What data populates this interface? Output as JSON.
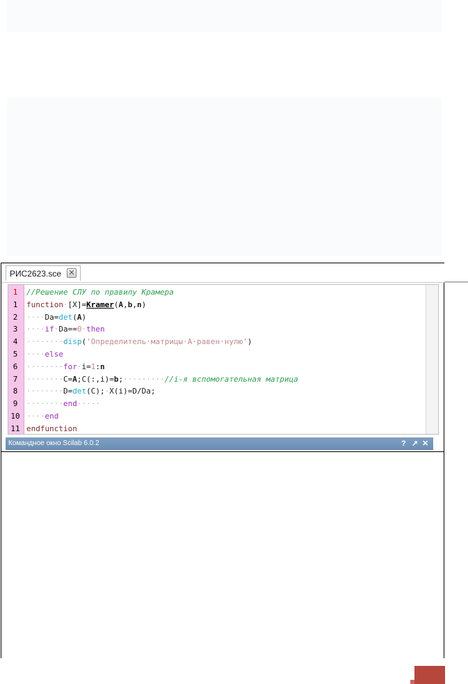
{
  "editor": {
    "tab_label": "РИС2623.sce",
    "tab_close_glyph": "✕",
    "lines": [
      {
        "num": "1",
        "tokens": [
          {
            "t": "//Решение СЛУ по правилу Крамера",
            "c": "cm"
          }
        ]
      },
      {
        "num": "1",
        "tokens": [
          {
            "t": "function",
            "c": "kw"
          },
          {
            "t": "·",
            "c": "dot"
          },
          {
            "t": "[X]",
            "c": "ident"
          },
          {
            "t": "=",
            "c": "ident"
          },
          {
            "t": "Kramer",
            "c": "under"
          },
          {
            "t": "(",
            "c": "ident"
          },
          {
            "t": "A",
            "c": "bold"
          },
          {
            "t": ",",
            "c": "ident"
          },
          {
            "t": "b",
            "c": "bold"
          },
          {
            "t": ",",
            "c": "ident"
          },
          {
            "t": "n",
            "c": "bold"
          },
          {
            "t": ")",
            "c": "ident"
          }
        ]
      },
      {
        "num": "2",
        "tokens": [
          {
            "t": "····",
            "c": "dot"
          },
          {
            "t": "Da",
            "c": "ident"
          },
          {
            "t": "=",
            "c": "ident"
          },
          {
            "t": "det",
            "c": "fn"
          },
          {
            "t": "(",
            "c": "ident"
          },
          {
            "t": "A",
            "c": "bold"
          },
          {
            "t": ")",
            "c": "ident"
          }
        ]
      },
      {
        "num": "3",
        "tokens": [
          {
            "t": "····",
            "c": "dot"
          },
          {
            "t": "if",
            "c": "kw2"
          },
          {
            "t": "·",
            "c": "dot"
          },
          {
            "t": "Da",
            "c": "ident"
          },
          {
            "t": "==",
            "c": "ident"
          },
          {
            "t": "0",
            "c": "num"
          },
          {
            "t": "·",
            "c": "dot"
          },
          {
            "t": "then",
            "c": "kw2"
          }
        ]
      },
      {
        "num": "4",
        "tokens": [
          {
            "t": "········",
            "c": "dot"
          },
          {
            "t": "disp",
            "c": "fn"
          },
          {
            "t": "(",
            "c": "ident"
          },
          {
            "t": "'Определитель·матрицы·А·равен·нулю'",
            "c": "str"
          },
          {
            "t": ")",
            "c": "ident"
          }
        ]
      },
      {
        "num": "5",
        "tokens": [
          {
            "t": "····",
            "c": "dot"
          },
          {
            "t": "else",
            "c": "kw2"
          }
        ]
      },
      {
        "num": "6",
        "tokens": [
          {
            "t": "········",
            "c": "dot"
          },
          {
            "t": "for",
            "c": "kw2"
          },
          {
            "t": "·",
            "c": "dot"
          },
          {
            "t": "i",
            "c": "ident"
          },
          {
            "t": "=",
            "c": "ident"
          },
          {
            "t": "1",
            "c": "num"
          },
          {
            "t": ":",
            "c": "ident"
          },
          {
            "t": "n",
            "c": "bold"
          }
        ]
      },
      {
        "num": "7",
        "tokens": [
          {
            "t": "········",
            "c": "dot"
          },
          {
            "t": "C",
            "c": "ident"
          },
          {
            "t": "=",
            "c": "ident"
          },
          {
            "t": "A",
            "c": "bold"
          },
          {
            "t": ";",
            "c": "ident"
          },
          {
            "t": "C",
            "c": "ident"
          },
          {
            "t": "(",
            "c": "ident"
          },
          {
            "t": ":",
            "c": "ident"
          },
          {
            "t": ",",
            "c": "ident"
          },
          {
            "t": "i",
            "c": "ident"
          },
          {
            "t": ")",
            "c": "ident"
          },
          {
            "t": "=",
            "c": "ident"
          },
          {
            "t": "b",
            "c": "bold"
          },
          {
            "t": ";",
            "c": "ident"
          },
          {
            "t": "·········",
            "c": "dot"
          },
          {
            "t": "//i-я вспомогательная матрица",
            "c": "cm"
          }
        ]
      },
      {
        "num": "8",
        "tokens": [
          {
            "t": "········",
            "c": "dot"
          },
          {
            "t": "D",
            "c": "ident"
          },
          {
            "t": "=",
            "c": "ident"
          },
          {
            "t": "det",
            "c": "fn"
          },
          {
            "t": "(",
            "c": "ident"
          },
          {
            "t": "C",
            "c": "ident"
          },
          {
            "t": ")",
            "c": "ident"
          },
          {
            "t": ";",
            "c": "ident"
          },
          {
            "t": "·",
            "c": "dot"
          },
          {
            "t": "X",
            "c": "ident"
          },
          {
            "t": "(",
            "c": "ident"
          },
          {
            "t": "i",
            "c": "ident"
          },
          {
            "t": ")",
            "c": "ident"
          },
          {
            "t": "=",
            "c": "ident"
          },
          {
            "t": "D",
            "c": "ident"
          },
          {
            "t": "/",
            "c": "ident"
          },
          {
            "t": "Da",
            "c": "ident"
          },
          {
            "t": ";",
            "c": "ident"
          }
        ]
      },
      {
        "num": "9",
        "tokens": [
          {
            "t": "········",
            "c": "dot"
          },
          {
            "t": "end",
            "c": "kw2"
          },
          {
            "t": "·····",
            "c": "dot"
          }
        ]
      },
      {
        "num": "10",
        "tokens": [
          {
            "t": "····",
            "c": "dot"
          },
          {
            "t": "end",
            "c": "kw2"
          }
        ]
      },
      {
        "num": "11",
        "tokens": [
          {
            "t": "endfunction",
            "c": "kw"
          }
        ]
      }
    ]
  },
  "console": {
    "title": "Командное окно Scilab 6.0.2",
    "help_glyph": "?",
    "undock_glyph": "↗",
    "close_glyph": "✕"
  }
}
